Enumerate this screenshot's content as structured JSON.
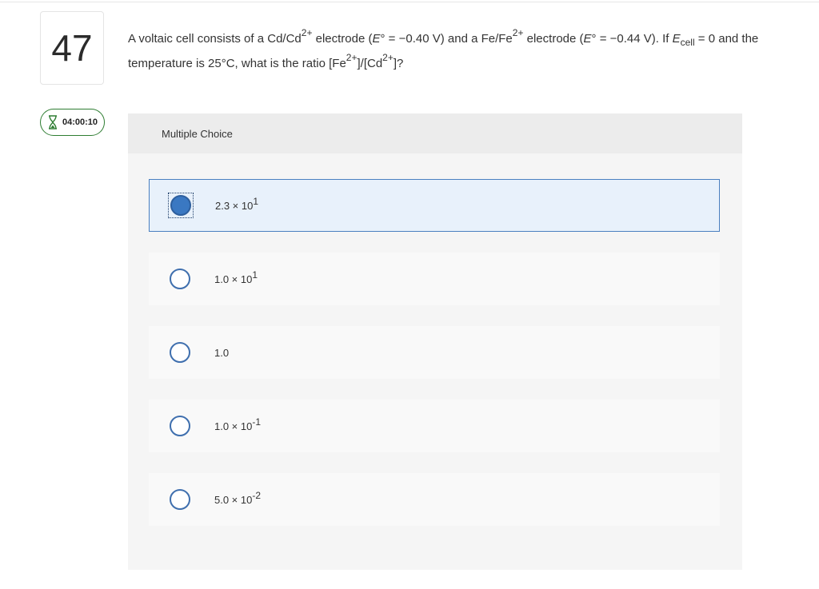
{
  "question": {
    "number": "47",
    "timer": "04:00:10",
    "text": {
      "p1": "A voltaic cell consists of a Cd/Cd",
      "p1_sup": "2+",
      "p2": " electrode (",
      "p2_e": "E",
      "p3": "° = −0.40 V) and a Fe/Fe",
      "p3_sup": "2+",
      "p4": " electrode (",
      "p4_e": "E",
      "p5": "° = −0.44 V). If ",
      "p5_e": "E",
      "p5_sub": "cell",
      "p6": " = 0 and the temperature is 25°C, what is the ratio [Fe",
      "p6_sup": "2+",
      "p7": "]/[Cd",
      "p7_sup": "2+",
      "p8": "]?"
    }
  },
  "panel": {
    "header": "Multiple Choice"
  },
  "choices": [
    {
      "base": "2.3 × 10",
      "exp": "1",
      "selected": true
    },
    {
      "base": "1.0 × 10",
      "exp": "1",
      "selected": false
    },
    {
      "base": "1.0",
      "exp": "",
      "selected": false
    },
    {
      "base": "1.0 × 10",
      "exp": "-1",
      "selected": false
    },
    {
      "base": "5.0 × 10",
      "exp": "-2",
      "selected": false
    }
  ],
  "icons": {
    "timer": "hourglass-icon"
  },
  "colors": {
    "timer_border": "#2e7d32",
    "radio": "#3f6fae",
    "selected_fill": "#3a78c2",
    "selected_bg": "#e8f1fb"
  }
}
